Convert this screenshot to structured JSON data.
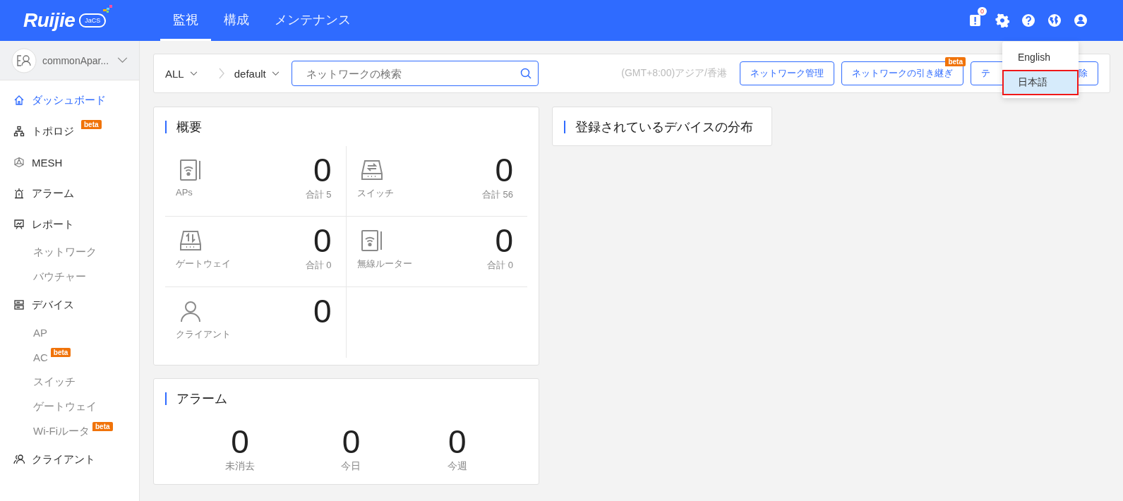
{
  "header": {
    "logo": "Ruijie",
    "logo_badge": "JaCS",
    "nav": [
      {
        "label": "監視",
        "selected": true
      },
      {
        "label": "構成",
        "selected": false
      },
      {
        "label": "メンテナンス",
        "selected": false
      }
    ],
    "alert_count": "0"
  },
  "account": {
    "name": "commonApar..."
  },
  "sidebar": {
    "items": [
      {
        "label": "ダッシュボード",
        "selected": true
      },
      {
        "label": "トポロジ",
        "selected": false,
        "badge": "beta"
      },
      {
        "label": "MESH",
        "selected": false
      },
      {
        "label": "アラーム",
        "selected": false
      },
      {
        "label": "レポート",
        "selected": false,
        "children": [
          {
            "label": "ネットワーク",
            "selected": false
          },
          {
            "label": "バウチャー",
            "selected": false
          }
        ]
      },
      {
        "label": "デバイス",
        "selected": false,
        "children": [
          {
            "label": "AP",
            "selected": false
          },
          {
            "label": "AC",
            "selected": false,
            "badge": "beta"
          },
          {
            "label": "スイッチ",
            "selected": false
          },
          {
            "label": "ゲートウェイ",
            "selected": false
          },
          {
            "label": "Wi-Fiルータ",
            "selected": false,
            "badge": "beta"
          }
        ]
      },
      {
        "label": "クライアント",
        "selected": false
      }
    ]
  },
  "toolbar": {
    "group": "ALL",
    "network": "default",
    "search": {
      "placeholder": "ネットワークの検索"
    },
    "timezone": "(GMT+8:00)アジア/香港",
    "buttons": [
      {
        "label": "ネットワーク管理"
      },
      {
        "label": "ネットワークの引き継ぎ",
        "badge": "beta"
      },
      {
        "label_start": "テ",
        "label_end": "除"
      }
    ]
  },
  "language_menu": {
    "items": [
      {
        "label": "English",
        "selected": false
      },
      {
        "label": "日本語",
        "selected": true
      }
    ]
  },
  "overview": {
    "title": "概要",
    "tiles": [
      {
        "label": "APs",
        "value": "0",
        "total": "合計 5"
      },
      {
        "label": "スイッチ",
        "value": "0",
        "total": "合計 56"
      },
      {
        "label": "ゲートウェイ",
        "value": "0",
        "total": "合計 0"
      },
      {
        "label": "無線ルーター",
        "value": "0",
        "total": "合計 0"
      },
      {
        "label": "クライアント",
        "value": "0"
      }
    ]
  },
  "distribution": {
    "title": "登録されているデバイスの分布"
  },
  "alarms": {
    "title": "アラーム",
    "stats": [
      {
        "value": "0",
        "label": "未消去"
      },
      {
        "value": "0",
        "label": "今日"
      },
      {
        "value": "0",
        "label": "今週"
      }
    ]
  }
}
